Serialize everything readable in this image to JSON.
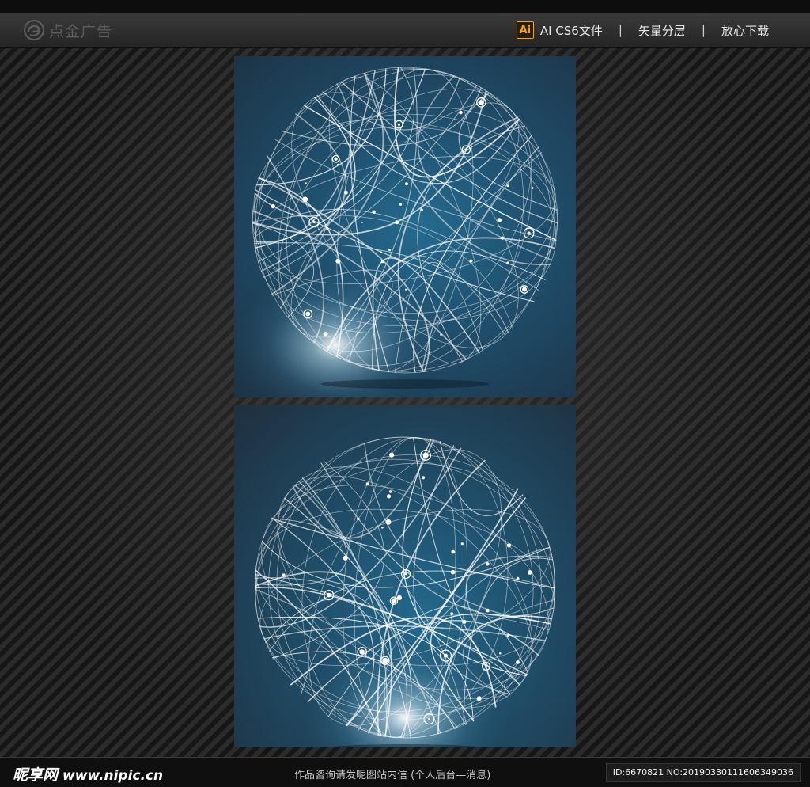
{
  "header": {
    "logo_text": "点金广告",
    "file_badge": "Ai",
    "file_type": "AI CS6文件",
    "separator": "|",
    "feature_layers": "矢量分层",
    "feature_download": "放心下载"
  },
  "panels": [
    {
      "label": "network-sphere-1"
    },
    {
      "label": "network-sphere-2"
    }
  ],
  "footer": {
    "site_brand": "昵享网",
    "site_url": "www.nipic.cn",
    "notice": "作品咨询请发昵图站内信 (个人后台—消息)",
    "image_id": "ID:6670821 NO:20190330111606349036"
  },
  "colors": {
    "accent_orange": "#f7a31c",
    "panel_blue": "#24698c",
    "panel_dark": "#1d3346"
  }
}
